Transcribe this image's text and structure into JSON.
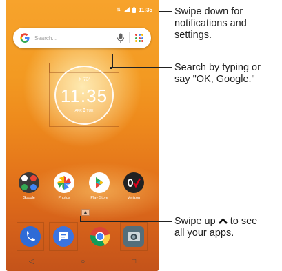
{
  "status": {
    "time": "11:35"
  },
  "search": {
    "placeholder": "Search..."
  },
  "clock": {
    "weather": "☀ 73°",
    "time": "11:35",
    "date_prefix": "APR ",
    "date_day": "3",
    "date_suffix": " TUE"
  },
  "apps": [
    {
      "label": "Google"
    },
    {
      "label": "Photos"
    },
    {
      "label": "Play Store"
    },
    {
      "label": "Verizon"
    }
  ],
  "callouts": {
    "notifications": [
      "Swipe down for",
      "notifications and",
      "settings."
    ],
    "search": [
      "Search by typing or",
      "say \"OK, Google.\""
    ],
    "apps_before": "Swipe up ",
    "apps_after": " to see",
    "apps_line2": "all your apps."
  },
  "colors": {
    "wallpaper_top": "#f7a32c",
    "wallpaper_bottom": "#c4531a",
    "phone_icon": "#2f6bd6",
    "messages_icon": "#3b74e0"
  }
}
